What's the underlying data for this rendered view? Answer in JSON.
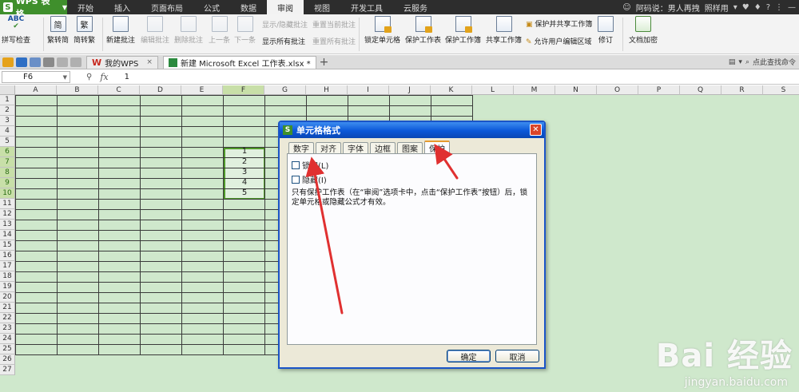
{
  "app": {
    "name": "WPS 表格",
    "logo_letter": "S"
  },
  "menu": {
    "items": [
      "开始",
      "插入",
      "页面布局",
      "公式",
      "数据",
      "审阅",
      "视图",
      "开发工具",
      "云服务"
    ],
    "active": "审阅",
    "right_text": "阿码说：男人再拽",
    "right_style": "照样用"
  },
  "ribbon": {
    "spell_check": "拼写检查",
    "trad_to_simp": "繁转简",
    "simp_to_trad": "简转繁",
    "new_comment": "新建批注",
    "edit_comment": "编辑批注",
    "delete_comment": "删除批注",
    "prev": "上一条",
    "next": "下一条",
    "show_hide_comment": "显示/隐藏批注",
    "show_all_comments": "显示所有批注",
    "reset_current_comment": "重置当前批注",
    "reset_all_comments": "重置所有批注",
    "lock_cell": "锁定单元格",
    "protect_sheet": "保护工作表",
    "protect_workbook": "保护工作簿",
    "share_workbook": "共享工作簿",
    "protect_and_share": "保护并共享工作簿",
    "allow_edit_ranges": "允许用户编辑区域",
    "track_changes": "修订",
    "encrypt_doc": "文档加密",
    "abc": "ABC",
    "jian": "简",
    "fan": "繁"
  },
  "tabs": {
    "my_wps": "我的WPS",
    "doc": "新建 Microsoft Excel 工作表.xlsx *",
    "search_hint": "点此查找命令"
  },
  "formula_bar": {
    "cell_ref": "F6",
    "fx": "fx",
    "value": "1"
  },
  "sheet": {
    "columns": [
      "A",
      "B",
      "C",
      "D",
      "E",
      "F",
      "G",
      "H",
      "I",
      "J",
      "K",
      "L",
      "M",
      "N",
      "O",
      "P",
      "Q",
      "R",
      "S"
    ],
    "rows": [
      "1",
      "2",
      "3",
      "4",
      "5",
      "6",
      "7",
      "8",
      "9",
      "10",
      "11",
      "12",
      "13",
      "14",
      "15",
      "16",
      "17",
      "18",
      "19",
      "20",
      "21",
      "22",
      "23",
      "24",
      "25",
      "26",
      "27"
    ],
    "selected_column": "F",
    "selected_rows": [
      "6",
      "7",
      "8",
      "9",
      "10"
    ],
    "cell_values": [
      "1",
      "2",
      "3",
      "4",
      "5"
    ]
  },
  "dialog": {
    "title": "单元格格式",
    "tabs": [
      "数字",
      "对齐",
      "字体",
      "边框",
      "图案",
      "保护"
    ],
    "active_tab": "保护",
    "lock_label": "锁定(L)",
    "lock_checked": false,
    "hide_label": "隐藏(I)",
    "hide_checked": false,
    "note": "只有保护工作表（在“审阅”选项卡中，点击“保护工作表”按钮）后，锁定单元格或隐藏公式才有效。",
    "ok": "确定",
    "cancel": "取消"
  },
  "watermark": {
    "main": "Bai 经验",
    "sub": "jingyan.baidu.com"
  },
  "colors": {
    "accent": "#3f8f2c",
    "sheet_bg": "#cfe8cc",
    "dialog_title": "#0a57d8",
    "arrow": "#e03030"
  }
}
